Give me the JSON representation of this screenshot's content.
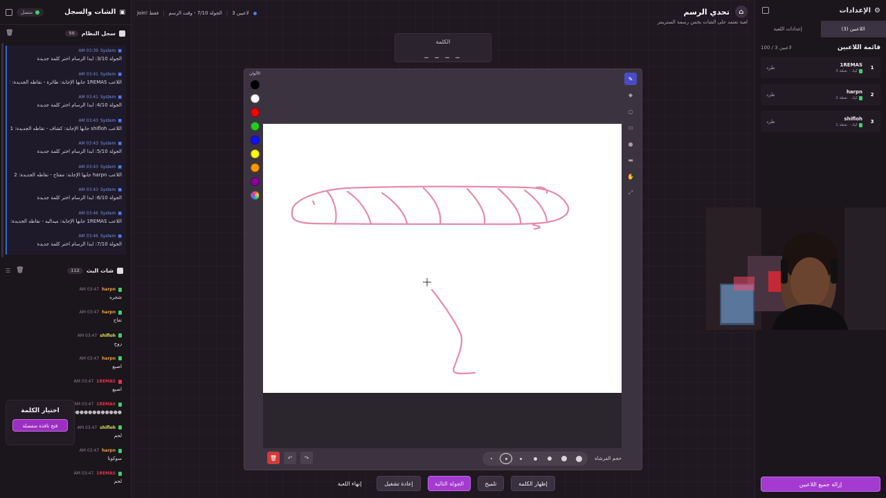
{
  "left": {
    "title": "الشات والسجل",
    "connection": "متصل",
    "system_log": {
      "title": "سجل النظام",
      "count": "50",
      "entries": [
        {
          "time": "03:39 AM",
          "source": "System",
          "text": "الجولة 3/10: ايدا الرسام اختر كلمة جديدة"
        },
        {
          "time": "03:41 AM",
          "source": "System",
          "text": "اللاعب 1REMAS جابها الإجابة: طائرة - نقاطه الجديدة: 2"
        },
        {
          "time": "03:41 AM",
          "source": "System",
          "text": "الجولة 4/10: ايدا الرسام اختر كلمة جديدة"
        },
        {
          "time": "03:43 AM",
          "source": "System",
          "text": "اللاعب shifloh جابها الإجابة: كشاف - نقاطه الجديدة: 1"
        },
        {
          "time": "03:43 AM",
          "source": "System",
          "text": "الجولة 5/10: ايدا الرسام اختر كلمة جديدة"
        },
        {
          "time": "03:43 AM",
          "source": "System",
          "text": "اللاعب harpn جابها الإجابة: مفتاح - نقاطه الجديدة: 2"
        },
        {
          "time": "03:43 AM",
          "source": "System",
          "text": "الجولة 6/10: ايدا الرسام اختر كلمة جديدة"
        },
        {
          "time": "03:46 AM",
          "source": "System",
          "text": "اللاعب 1REMAS جابها الإجابة: ميداليه - نقاطه الجديدة: 3"
        },
        {
          "time": "03:46 AM",
          "source": "System",
          "text": "الجولة 7/10: ايدا الرسام اختر كلمة جديدة"
        }
      ]
    },
    "live_chat": {
      "title": "شات البث",
      "count": "112",
      "messages": [
        {
          "time": "03:47 AM",
          "user": "harpn",
          "color": "#e8a046",
          "badge": "green",
          "text": "شجره"
        },
        {
          "time": "03:47 AM",
          "user": "harpn",
          "color": "#e8a046",
          "badge": "green",
          "text": "تفاح"
        },
        {
          "time": "03:47 AM",
          "user": "shifloh",
          "color": "#d8e35a",
          "badge": "green",
          "text": "زوج"
        },
        {
          "time": "03:47 AM",
          "user": "harpn",
          "color": "#e8a046",
          "badge": "green",
          "text": "اصبع"
        },
        {
          "time": "03:47 AM",
          "user": "1REMAS",
          "color": "#e5334a",
          "badge": "red",
          "text": "اصبع"
        },
        {
          "time": "03:47 AM",
          "user": "1REMAS",
          "color": "#e5334a",
          "badge": "green",
          "text": "●●●●●●●●●●●●●●"
        },
        {
          "time": "03:47 AM",
          "user": "shifloh",
          "color": "#d8e35a",
          "badge": "green",
          "text": "لحم"
        },
        {
          "time": "03:47 AM",
          "user": "harpn",
          "color": "#e8a046",
          "badge": "green",
          "text": "سوكوتا"
        },
        {
          "time": "03:47 AM",
          "user": "1REMAS",
          "color": "#e5334a",
          "badge": "green",
          "text": "لحم"
        }
      ]
    },
    "word_choice": {
      "title": "اختيار الكلمة",
      "button": "فتح نافذة منفصلة"
    }
  },
  "topbar": {
    "title": "تحدي الرسم",
    "subtitle": "لعبة تعتمد على الشات يخمن رسمة الستريمر",
    "players": "3 لاعبين",
    "round": "الجولة 7/10 - وقت الرسم",
    "join": "join! فقط"
  },
  "word_box": {
    "label": "الكلمة",
    "mask": "_ _ _ _"
  },
  "canvas": {
    "colors_label": "الألوان",
    "palette": [
      "#000000",
      "#ffffff",
      "#ff0000",
      "#22cc22",
      "#1010ff",
      "#ffff00",
      "#ff9900",
      "#880099"
    ],
    "tools": [
      "pen-icon",
      "eraser-icon",
      "circle-icon",
      "rectangle-icon",
      "fill-icon",
      "line-icon",
      "hand-icon",
      "expand-icon"
    ],
    "brush_label": "حجم الفرشاة",
    "stroke_color": "#e58aa8"
  },
  "actions": {
    "end": "إنهاء اللعبة",
    "restart": "إعادة تشغيل",
    "next_round": "الجولة التالية",
    "hint": "تلميح",
    "reveal": "إظهار الكلمة"
  },
  "right": {
    "title": "الإعدادات",
    "tabs": [
      "اللاعبين (3)",
      "إعدادات اللعبة"
    ],
    "list_title": "قائمة اللاعبين",
    "list_count": "100 / 3 لاعبين",
    "kick": "طرد",
    "players": [
      {
        "rank": "1",
        "name": "1REMAS",
        "meta": "3 نقطة",
        "role": "كيك"
      },
      {
        "rank": "2",
        "name": "harpn",
        "meta": "2 نقطة",
        "role": "كيك"
      },
      {
        "rank": "3",
        "name": "shifloh",
        "meta": "1 نقطة",
        "role": "كيك"
      }
    ],
    "remove_all": "إزالة جميع اللاعبين"
  }
}
